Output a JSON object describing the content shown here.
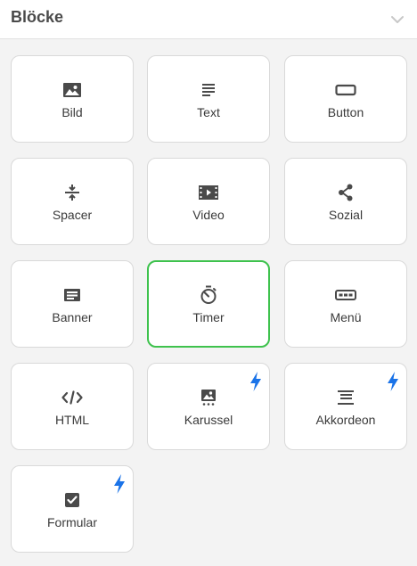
{
  "header": {
    "title": "Blöcke"
  },
  "blocks": [
    {
      "label": "Bild",
      "icon": "image-icon",
      "premium": false,
      "selected": false
    },
    {
      "label": "Text",
      "icon": "text-icon",
      "premium": false,
      "selected": false
    },
    {
      "label": "Button",
      "icon": "button-icon",
      "premium": false,
      "selected": false
    },
    {
      "label": "Spacer",
      "icon": "spacer-icon",
      "premium": false,
      "selected": false
    },
    {
      "label": "Video",
      "icon": "video-icon",
      "premium": false,
      "selected": false
    },
    {
      "label": "Sozial",
      "icon": "share-icon",
      "premium": false,
      "selected": false
    },
    {
      "label": "Banner",
      "icon": "banner-icon",
      "premium": false,
      "selected": false
    },
    {
      "label": "Timer",
      "icon": "timer-icon",
      "premium": false,
      "selected": true
    },
    {
      "label": "Menü",
      "icon": "menu-icon",
      "premium": false,
      "selected": false
    },
    {
      "label": "HTML",
      "icon": "code-icon",
      "premium": false,
      "selected": false
    },
    {
      "label": "Karussel",
      "icon": "carousel-icon",
      "premium": true,
      "selected": false
    },
    {
      "label": "Akkordeon",
      "icon": "accordion-icon",
      "premium": true,
      "selected": false
    },
    {
      "label": "Formular",
      "icon": "form-icon",
      "premium": true,
      "selected": false
    }
  ],
  "colors": {
    "selected_border": "#3ec24d",
    "premium_bolt": "#1a73e8",
    "icon": "#4a4a4a"
  }
}
